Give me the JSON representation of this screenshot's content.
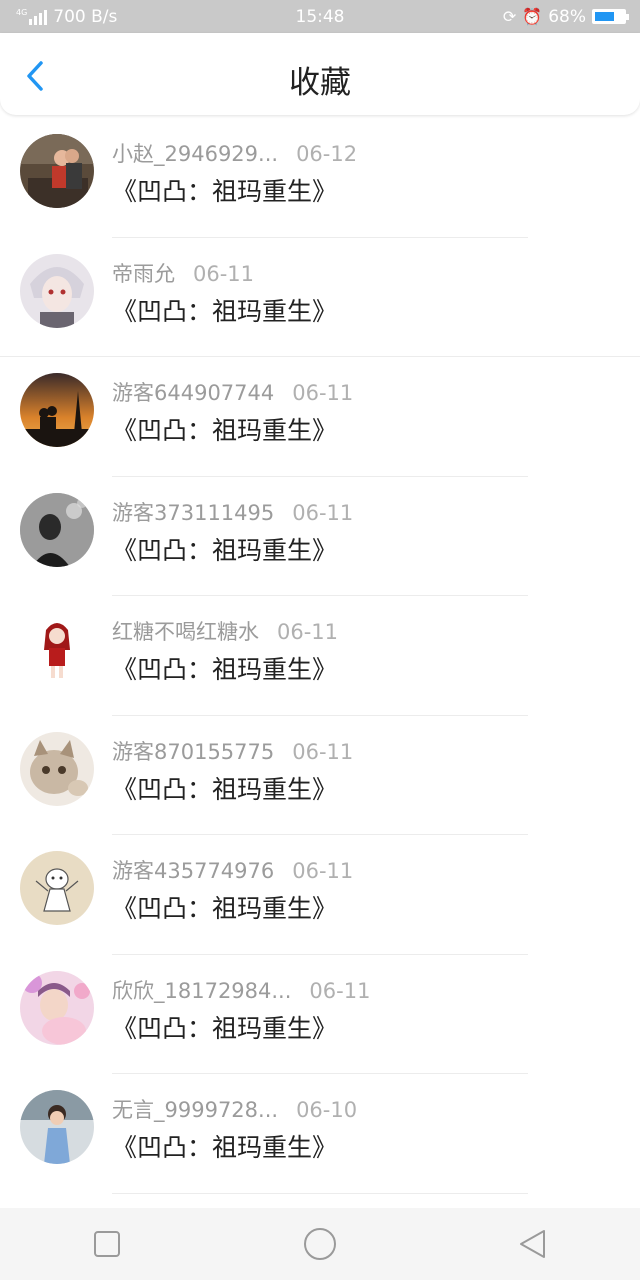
{
  "status_bar": {
    "network": "4G",
    "speed": "700 B/s",
    "time": "15:48",
    "battery_percent": "68%",
    "battery_level": 0.68
  },
  "header": {
    "title": "收藏"
  },
  "items": [
    {
      "user": "小赵_2946929...",
      "date": "06-12",
      "book": "《凹凸：祖玛重生》"
    },
    {
      "user": "帝雨允",
      "date": "06-11",
      "book": "《凹凸：祖玛重生》"
    },
    {
      "user": "游客644907744",
      "date": "06-11",
      "book": "《凹凸：祖玛重生》"
    },
    {
      "user": "游客373111495",
      "date": "06-11",
      "book": "《凹凸：祖玛重生》"
    },
    {
      "user": "红糖不喝红糖水",
      "date": "06-11",
      "book": "《凹凸：祖玛重生》"
    },
    {
      "user": "游客870155775",
      "date": "06-11",
      "book": "《凹凸：祖玛重生》"
    },
    {
      "user": "游客435774976",
      "date": "06-11",
      "book": "《凹凸：祖玛重生》"
    },
    {
      "user": "欣欣_18172984...",
      "date": "06-11",
      "book": "《凹凸：祖玛重生》"
    },
    {
      "user": "无言_9999728...",
      "date": "06-10",
      "book": "《凹凸：祖玛重生》"
    }
  ],
  "colors": {
    "accent": "#2196f3",
    "status_bar_bg": "#c9c9c9",
    "meta_text": "#9b9b9b"
  }
}
